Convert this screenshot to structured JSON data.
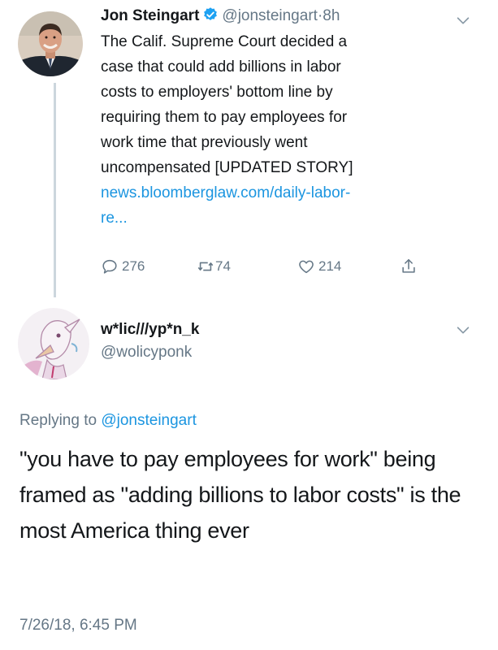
{
  "original_tweet": {
    "author_name": "Jon Steingart",
    "handle": "@jonsteingart",
    "separator": "·",
    "time": "8h",
    "text_lines": [
      "The Calif. Supreme Court decided a",
      "case that could add billions in labor",
      "costs to employers' bottom line by",
      "requiring them to pay employees for",
      "work time that previously went",
      "uncompensated [UPDATED STORY]"
    ],
    "link_lines": [
      "news.bloomberglaw.com/daily-labor-",
      "re..."
    ],
    "actions": {
      "replies": "276",
      "retweets": "74",
      "likes": "214"
    }
  },
  "reply_tweet": {
    "author_name": "w*lic///yp*n_k",
    "handle": "@wolicyponk",
    "replying_prefix": "Replying to",
    "replying_mention": "@jonsteingart",
    "text": "\"you have to pay employees for work\" being framed as \"adding billions to labor costs\" is the most America thing ever",
    "timestamp": "7/26/18, 6:45 PM"
  },
  "colors": {
    "link": "#1b95e0",
    "secondary_text": "#657786",
    "primary_text": "#14171a",
    "verified": "#1da1f2",
    "thread_line": "#ccd6dd"
  },
  "icons": [
    "verified-badge-icon",
    "chevron-down-icon",
    "reply-icon",
    "retweet-icon",
    "like-icon",
    "share-icon"
  ]
}
